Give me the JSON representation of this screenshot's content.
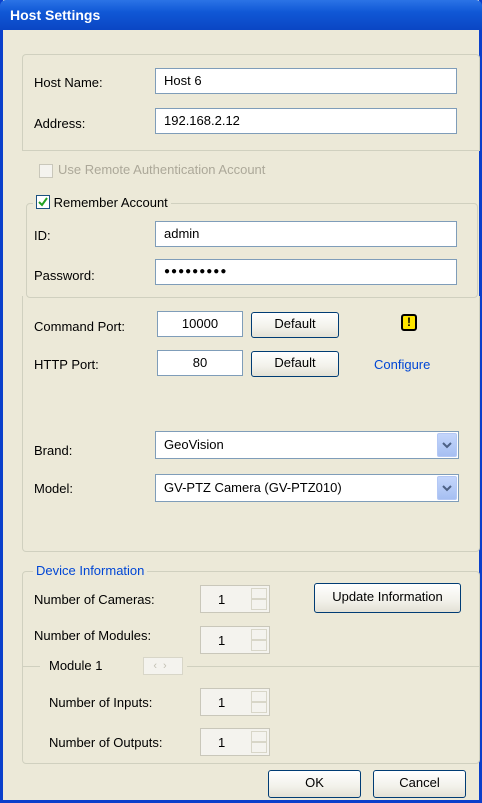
{
  "window": {
    "title": "Host Settings"
  },
  "host": {
    "name_label": "Host Name:",
    "name_value": "Host 6",
    "address_label": "Address:",
    "address_value": "192.168.2.12"
  },
  "auth": {
    "remote_auth_label": "Use Remote Authentication Account",
    "remember_label": "Remember Account",
    "id_label": "ID:",
    "id_value": "admin",
    "password_label": "Password:",
    "password_value": "●●●●●●●●●"
  },
  "ports": {
    "command_label": "Command Port:",
    "command_value": "10000",
    "http_label": "HTTP Port:",
    "http_value": "80",
    "default_label": "Default",
    "configure_label": "Configure",
    "warning_icon": "warning-icon",
    "warning_glyph": "!"
  },
  "device": {
    "brand_label": "Brand:",
    "brand_value": "GeoVision",
    "model_label": "Model:",
    "model_value": "GV-PTZ Camera (GV-PTZ010)"
  },
  "info": {
    "group_label": "Device Information",
    "cameras_label": "Number of Cameras:",
    "cameras_value": "1",
    "update_label": "Update Information",
    "modules_label": "Number of Modules:",
    "modules_value": "1",
    "module_label": "Module 1",
    "inputs_label": "Number of Inputs:",
    "inputs_value": "1",
    "outputs_label": "Number of Outputs:",
    "outputs_value": "1"
  },
  "footer": {
    "ok_label": "OK",
    "cancel_label": "Cancel"
  },
  "colors": {
    "title_bar": "#0A46C4",
    "link": "#0046D5",
    "warning_fill": "#FFE600",
    "check": "#21A121"
  }
}
